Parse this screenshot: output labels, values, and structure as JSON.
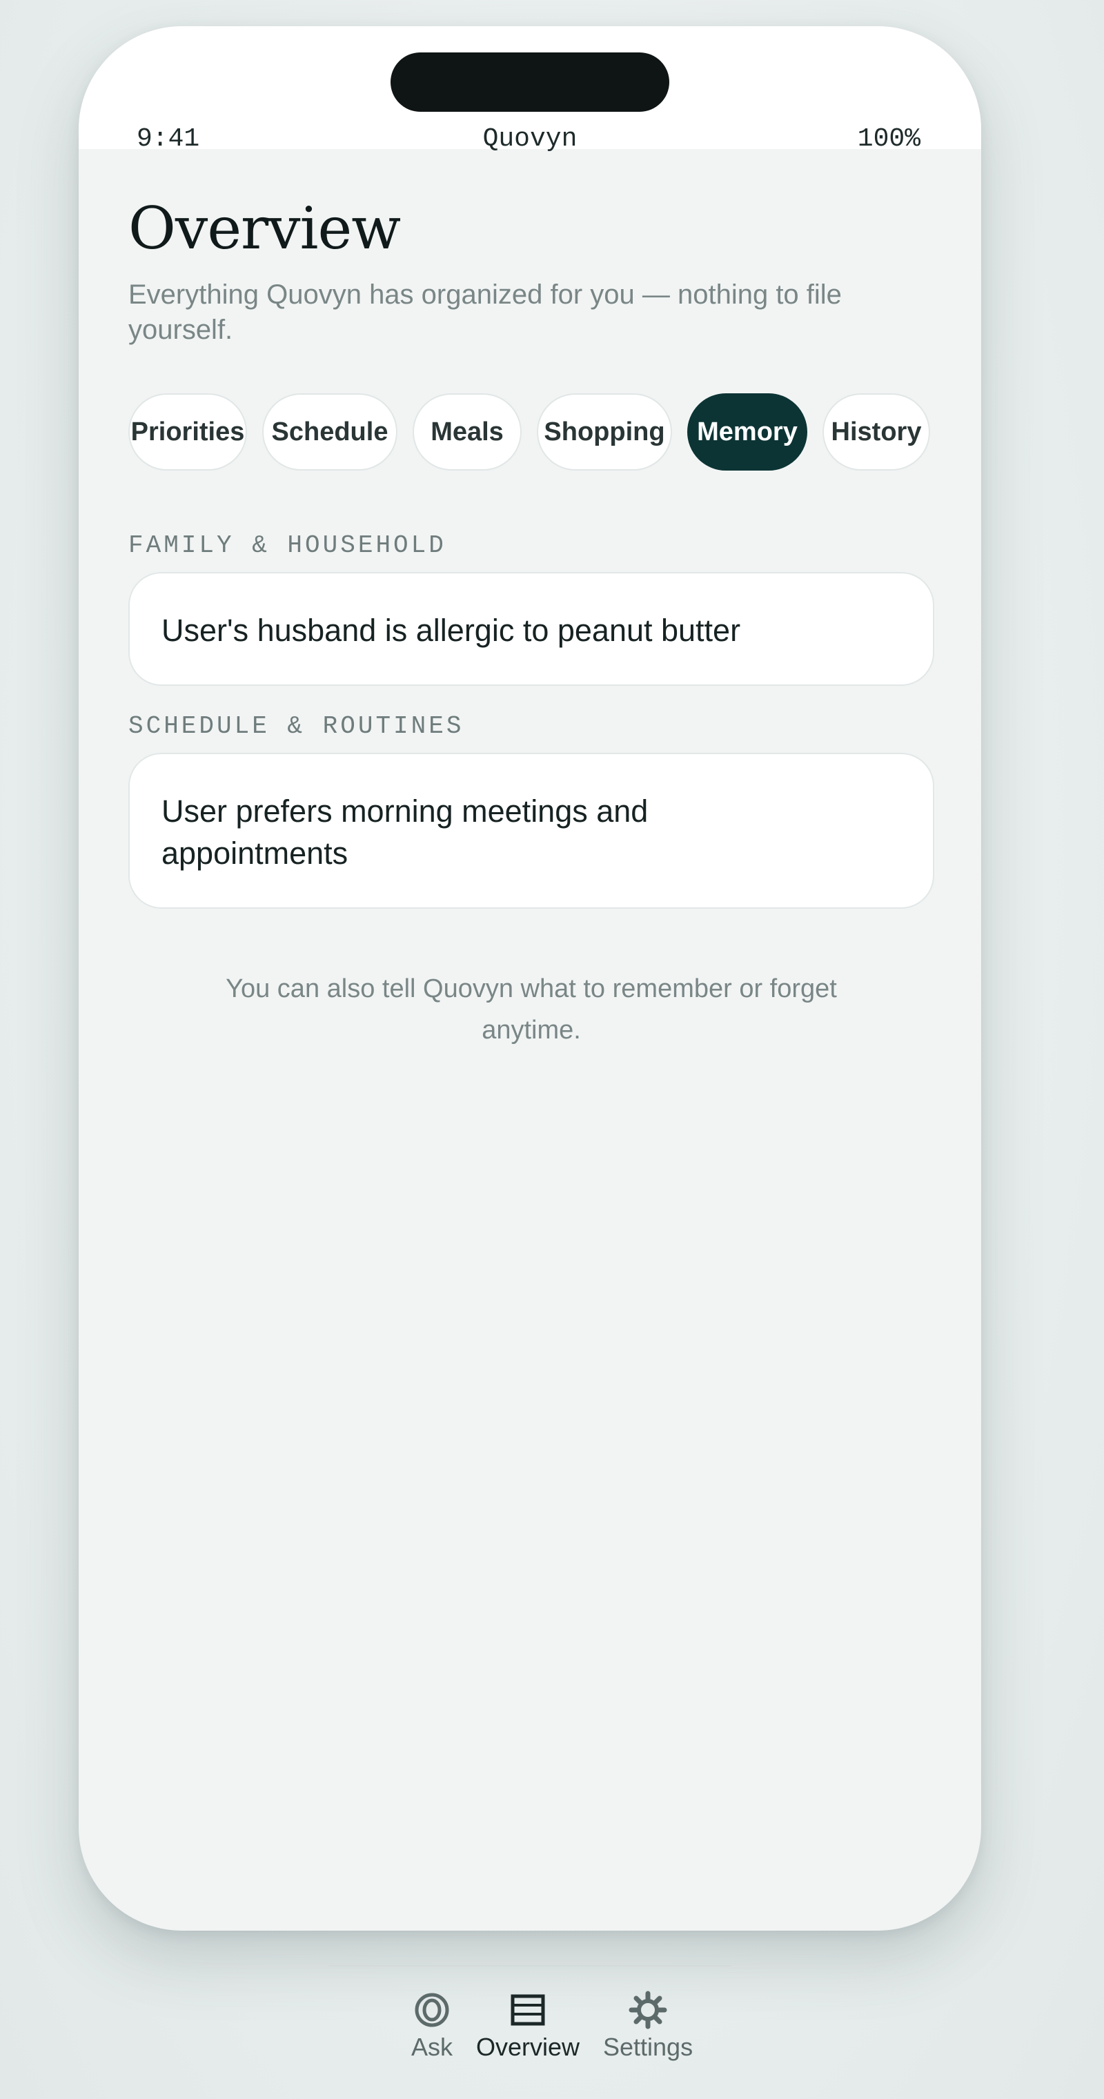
{
  "status_bar": {
    "time": "9:41",
    "app_name": "Quovyn",
    "battery": "100%"
  },
  "page": {
    "title": "Overview",
    "subtitle": "Everything Quovyn has organized for you — nothing to file yourself."
  },
  "tabs": [
    {
      "label": "Priorities",
      "active": false
    },
    {
      "label": "Schedule",
      "active": false
    },
    {
      "label": "Meals",
      "active": false
    },
    {
      "label": "Shopping",
      "active": false
    },
    {
      "label": "Memory",
      "active": true
    },
    {
      "label": "History",
      "active": false
    }
  ],
  "sections": [
    {
      "label": "FAMILY & HOUSEHOLD",
      "items": [
        "User's husband is allergic to peanut butter"
      ]
    },
    {
      "label": "SCHEDULE & ROUTINES",
      "items": [
        "User prefers morning meetings and appointments"
      ]
    }
  ],
  "footnote": "You can also tell Quovyn what to remember or forget anytime.",
  "bottom_nav": [
    {
      "label": "Ask",
      "icon": "ask-icon",
      "active": false
    },
    {
      "label": "Overview",
      "icon": "list-icon",
      "active": true
    },
    {
      "label": "Settings",
      "icon": "gear-icon",
      "active": false
    }
  ],
  "colors": {
    "accent": "#0d3434",
    "background": "#f2f4f4",
    "card": "#ffffff",
    "muted_text": "#7a8686"
  }
}
